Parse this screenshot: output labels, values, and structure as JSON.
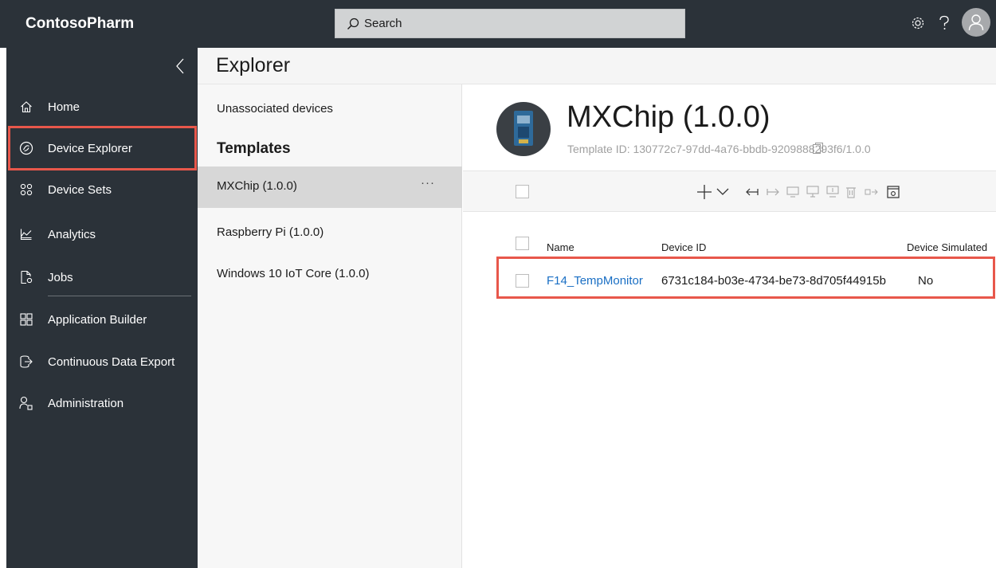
{
  "header": {
    "brand": "ContosoPharm",
    "search_placeholder": "Search",
    "icons": [
      "settings-icon",
      "help-icon",
      "user-avatar-icon"
    ]
  },
  "sidebar": {
    "items": [
      {
        "label": "Home",
        "icon": "home-icon"
      },
      {
        "label": "Device Explorer",
        "icon": "device-explorer-icon",
        "active": true
      },
      {
        "label": "Device Sets",
        "icon": "device-sets-icon"
      },
      {
        "label": "Analytics",
        "icon": "analytics-icon"
      },
      {
        "label": "Jobs",
        "icon": "jobs-icon"
      },
      {
        "label": "Application Builder",
        "icon": "app-builder-icon"
      },
      {
        "label": "Continuous Data Export",
        "icon": "data-export-icon"
      },
      {
        "label": "Administration",
        "icon": "administration-icon"
      }
    ]
  },
  "explorer": {
    "title": "Explorer",
    "unassociated": "Unassociated devices",
    "templates_heading": "Templates",
    "templates": [
      {
        "label": "MXChip (1.0.0)",
        "selected": true
      },
      {
        "label": "Raspberry Pi (1.0.0)"
      },
      {
        "label": "Windows 10 IoT Core (1.0.0)"
      }
    ],
    "more_label": "···"
  },
  "main": {
    "device_title": "MXChip (1.0.0)",
    "template_id": "Template ID: 130772c7-97dd-4a76-bbdb-9209888293f6/1.0.0",
    "toolbar_icons": [
      "add-icon",
      "chevron-down-icon",
      "import-icon",
      "export-icon",
      "block-icon",
      "unblock-icon",
      "migrate-icon",
      "delete-icon",
      "columns-icon",
      "settings-panel-icon"
    ],
    "columns": [
      "Name",
      "Device ID",
      "Device Simulated"
    ],
    "rows": [
      {
        "name": "F14_TempMonitor",
        "device_id": "6731c184-b03e-4734-be73-8d705f44915b",
        "simulated": "No"
      }
    ]
  },
  "colors": {
    "dark_bg": "#2b3239",
    "highlight": "#e8574b",
    "link": "#1a6fc4"
  }
}
